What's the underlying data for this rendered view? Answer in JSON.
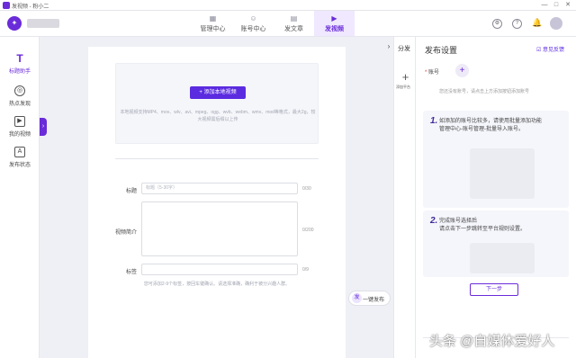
{
  "window": {
    "title": "发视频 - 粉小二",
    "controls": [
      "—",
      "□",
      "✕"
    ]
  },
  "topnav": {
    "brand_icon": "logo-icon",
    "tabs": [
      {
        "label": "管理中心",
        "icon": "grid-icon"
      },
      {
        "label": "账号中心",
        "icon": "user-icon"
      },
      {
        "label": "发文章",
        "icon": "article-icon"
      },
      {
        "label": "发视频",
        "icon": "video-icon",
        "active": true
      }
    ],
    "right_icons": [
      "settings-icon",
      "help-icon",
      "bell-icon"
    ]
  },
  "sidebar": {
    "items": [
      {
        "label": "标题助手",
        "glyph": "T",
        "active": true
      },
      {
        "label": "热点发现",
        "glyph": "◎"
      },
      {
        "label": "我的视频",
        "glyph": "▶"
      },
      {
        "label": "发布状态",
        "glyph": "A"
      }
    ],
    "collapse_glyph": "›"
  },
  "upload": {
    "button_label": "+ 添加本地视频",
    "hint": "本地视频支持MP4、mov、wlv、avi、mpeg、ogg、wvb、webm、wmv、mod等格式，最大2g，较大视频需后缀以上传"
  },
  "form": {
    "title_label": "标题",
    "title_placeholder": "标题（5-30字）",
    "title_counter": "0/30",
    "intro_label": "视频简介",
    "intro_counter": "0/200",
    "tags_label": "标签",
    "tags_counter": "0/9",
    "tags_hint": "您可添加2-9个标签，按回车键确认。请选择准确，确利于被分兴趣人群。"
  },
  "publish": {
    "oneclick_label": "一键发布",
    "oneclick_glyph": "发"
  },
  "middle_strip": {
    "collapse_glyph": "›",
    "title": "分发",
    "add_platform_label": "添加平台",
    "add_glyph": "+"
  },
  "settings": {
    "title": "发布设置",
    "feedback_label": "意见反馈",
    "account_required": "*",
    "account_label": "账号",
    "add_glyph": "+",
    "account_hint": "您还没有账号，请点击上方添加按钮添加账号",
    "guide_steps": [
      {
        "num": "1.",
        "text": "如添加的账号比较多，请使用批量添加功能\n管理中心-账号管理-批量导入账号。"
      },
      {
        "num": "2.",
        "text": "完成账号选择后\n请点击下一步跳转至平台规则设置。"
      }
    ],
    "next_button": "下一步"
  },
  "watermark": "头条 @自媒体爱好人",
  "colors": {
    "brand": "#6a2bd9",
    "primary_button": "#5b2be0",
    "page_bg": "#eef0f5"
  }
}
